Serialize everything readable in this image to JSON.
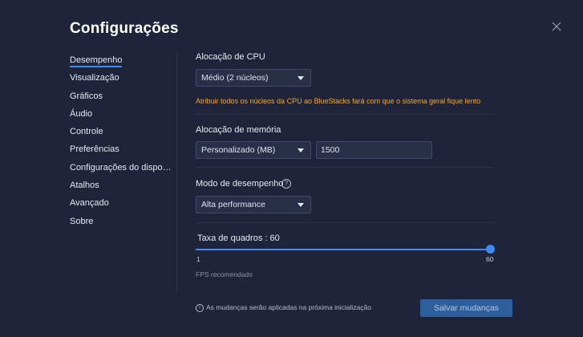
{
  "header": {
    "title": "Configurações"
  },
  "sidebar": {
    "items": [
      {
        "label": "Desempenho"
      },
      {
        "label": "Visualização"
      },
      {
        "label": "Gráficos"
      },
      {
        "label": "Áudio"
      },
      {
        "label": "Controle"
      },
      {
        "label": "Preferências"
      },
      {
        "label": "Configurações do dispositivo"
      },
      {
        "label": "Atalhos"
      },
      {
        "label": "Avançado"
      },
      {
        "label": "Sobre"
      }
    ]
  },
  "cpu": {
    "label": "Alocação de CPU",
    "selected": "Médio (2 núcleos)",
    "warning": "Atribuir todos os núcleos da CPU ao BlueStacks fará com que o sistema geral fique lento"
  },
  "memory": {
    "label": "Alocação de memória",
    "selected": "Personalizado (MB)",
    "value": "1500"
  },
  "performance": {
    "label": "Modo de desempenho",
    "help": "?",
    "selected": "Alta performance"
  },
  "framerate": {
    "label": "Taxa de quadros : 60",
    "min": "1",
    "max": "60",
    "value": 60,
    "recommended_label": "FPS recomendado"
  },
  "footer": {
    "note": "As mudanças serão aplicadas na próxima inicialização",
    "info_icon": "i",
    "save_label": "Salvar mudanças"
  },
  "colors": {
    "background": "#1f243a",
    "accent": "#3e8bf2",
    "warning": "#f5a623",
    "button": "#2d5e9e"
  }
}
